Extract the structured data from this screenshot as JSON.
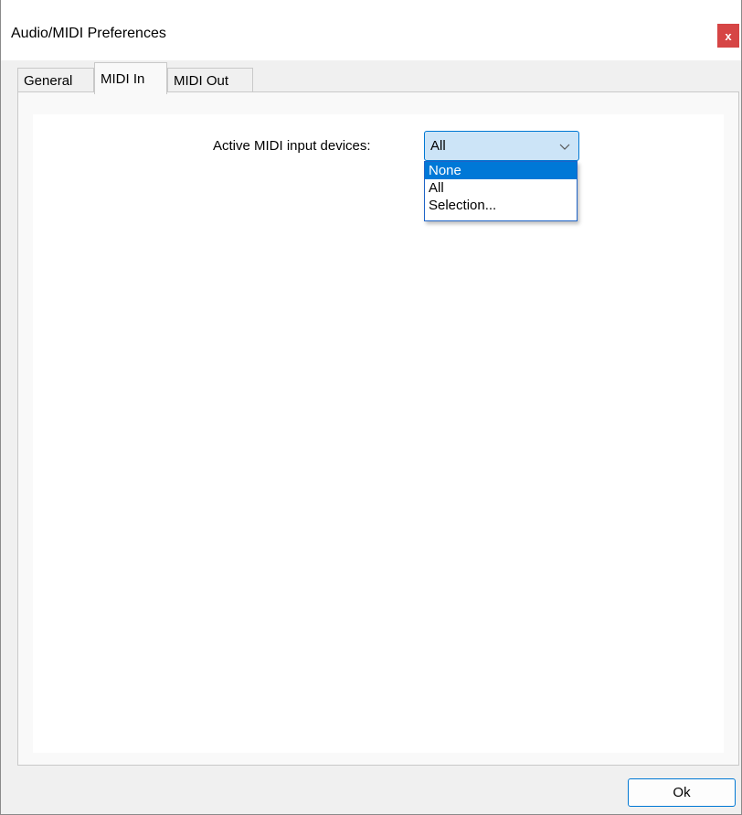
{
  "window": {
    "title": "Audio/MIDI Preferences",
    "close_label": "x",
    "accent_color": "#0078d4",
    "close_color": "#d64545"
  },
  "tabs": [
    {
      "label": "General",
      "active": false
    },
    {
      "label": "MIDI In",
      "active": true
    },
    {
      "label": "MIDI Out",
      "active": false
    }
  ],
  "midi_in": {
    "device_label": "Active MIDI input devices:",
    "device_selected": "All",
    "device_options": [
      {
        "label": "None",
        "highlighted": true
      },
      {
        "label": "All",
        "highlighted": false
      },
      {
        "label": "Selection...",
        "highlighted": false
      }
    ]
  },
  "footer": {
    "ok_label": "Ok"
  },
  "icons": {
    "combo_arrow": "chevron-down-icon",
    "close": "close-icon"
  }
}
